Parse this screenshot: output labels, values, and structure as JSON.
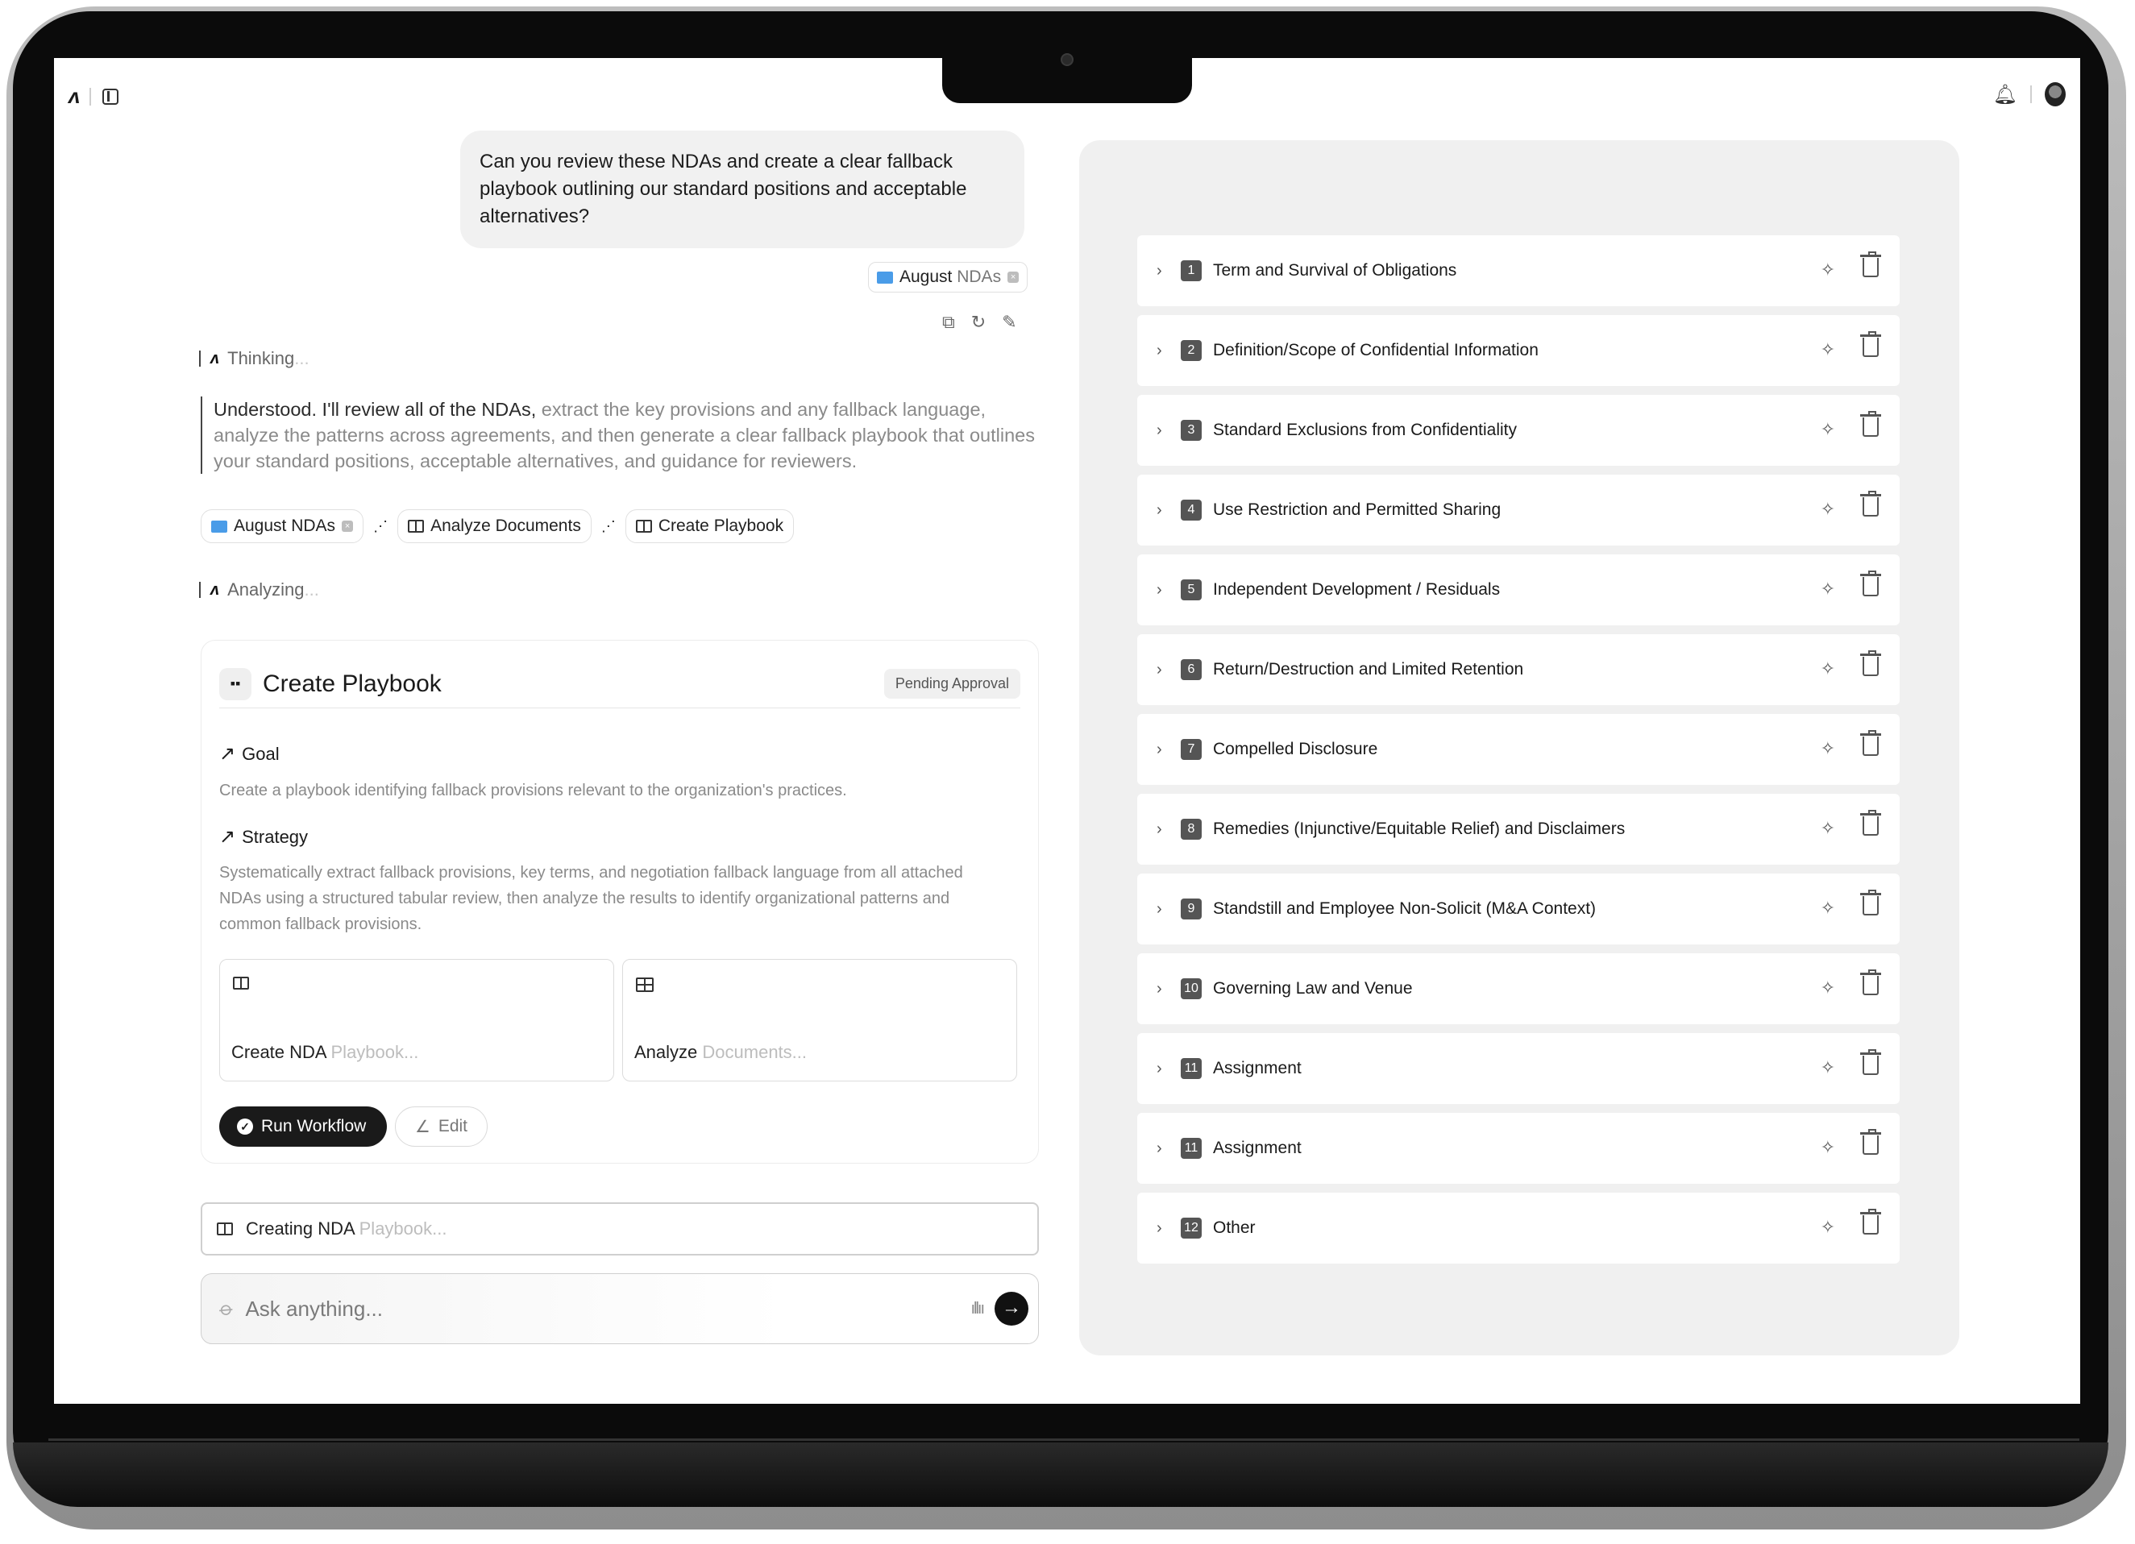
{
  "top_bar": {
    "logo": "ʌ"
  },
  "chat": {
    "user_message": "Can you review these NDAs and create a clear fallback playbook outlining our standard positions and acceptable alternatives?",
    "attachment": {
      "name_main": "August",
      "name_muted": " NDAs"
    },
    "thinking": {
      "label": "Thinking",
      "fade": "..."
    },
    "assistant_main": "Understood. I'll review all of the NDAs,",
    "assistant_dim": " extract the key provisions and any fallback language, analyze the patterns across agreements, and then generate a clear fallback playbook that outlines your standard positions, acceptable alternatives, and guidance for reviewers.",
    "steps": {
      "source": "August NDAs",
      "analyze": "Analyze Documents",
      "create": "Create Playbook"
    },
    "analyzing": {
      "label": "Analyzing",
      "fade": "..."
    }
  },
  "card": {
    "title": "Create Playbook",
    "status": "Pending Approval",
    "goal_label": "Goal",
    "goal_text": "Create a playbook identifying fallback provisions relevant to the organization's practices.",
    "strategy_label": "Strategy",
    "strategy_text": "Systematically extract fallback provisions, key terms, and negotiation fallback language from all attached NDAs using a structured tabular review, then analyze the results to identify organizational patterns and common fallback provisions.",
    "workflow_1": {
      "main": "Create NDA",
      "fade": " Playbook..."
    },
    "workflow_2": {
      "main": "Analyze",
      "fade": " Documents..."
    },
    "run_label": "Run Workflow",
    "edit_label": "Edit"
  },
  "creating": {
    "main": "Creating NDA",
    "fade": " Playbook..."
  },
  "input": {
    "placeholder": "Ask anything..."
  },
  "playbook_sections": [
    {
      "num": "1",
      "title": "Term and Survival of Obligations"
    },
    {
      "num": "2",
      "title": "Definition/Scope of Confidential Information"
    },
    {
      "num": "3",
      "title": "Standard Exclusions from Confidentiality"
    },
    {
      "num": "4",
      "title": "Use Restriction and Permitted Sharing"
    },
    {
      "num": "5",
      "title": "Independent Development / Residuals"
    },
    {
      "num": "6",
      "title": "Return/Destruction and Limited Retention"
    },
    {
      "num": "7",
      "title": "Compelled Disclosure"
    },
    {
      "num": "8",
      "title": "Remedies (Injunctive/Equitable Relief) and Disclaimers"
    },
    {
      "num": "9",
      "title": "Standstill and Employee Non-Solicit (M&A Context)"
    },
    {
      "num": "10",
      "title": "Governing Law and Venue"
    },
    {
      "num": "11",
      "title": "Assignment"
    },
    {
      "num": "11",
      "title": "Assignment"
    },
    {
      "num": "12",
      "title": "Other"
    }
  ],
  "icons": [
    "logo-icon",
    "sidebar-toggle-icon",
    "bell-icon",
    "avatar",
    "folder-icon",
    "copy-icon",
    "refresh-icon",
    "edit-icon",
    "book-icon",
    "table-icon",
    "check-icon",
    "paperclip-icon",
    "waveform-icon",
    "send-arrow-icon",
    "chevron-right-icon",
    "sparkle-icon",
    "trash-icon"
  ]
}
